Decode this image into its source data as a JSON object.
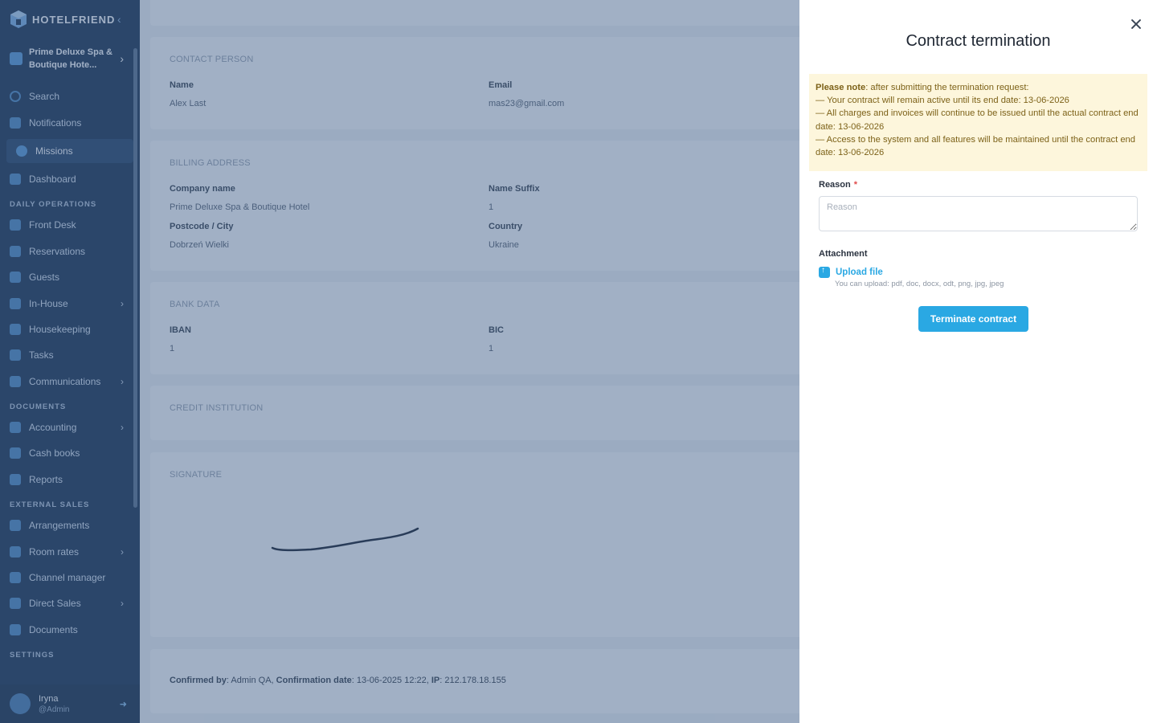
{
  "sidebar": {
    "brand": "HOTELFRIEND",
    "hotel_name": "Prime Deluxe Spa & Boutique Hote...",
    "search": "Search",
    "notifications": "Notifications",
    "missions": "Missions",
    "dashboard": "Dashboard",
    "sections": {
      "daily": "DAILY OPERATIONS",
      "documents": "DOCUMENTS",
      "external": "EXTERNAL SALES",
      "settings": "SETTINGS"
    },
    "daily_items": [
      "Front Desk",
      "Reservations",
      "Guests",
      "In-House",
      "Housekeeping",
      "Tasks",
      "Communications"
    ],
    "document_items": [
      "Accounting",
      "Cash books",
      "Reports"
    ],
    "external_items": [
      "Arrangements",
      "Room rates",
      "Channel manager",
      "Direct Sales",
      "Documents"
    ],
    "user": {
      "name": "Iryna",
      "role": "@Admin"
    }
  },
  "main": {
    "contact": {
      "title": "CONTACT PERSON",
      "name_label": "Name",
      "name_value": "Alex Last",
      "email_label": "Email",
      "email_value": "mas23@gmail.com"
    },
    "billing": {
      "title": "BILLING ADDRESS",
      "company_label": "Company name",
      "company_value": "Prime Deluxe Spa & Boutique Hotel",
      "suffix_label": "Name Suffix",
      "suffix_value": "1",
      "postcode_label": "Postcode / City",
      "postcode_value": "Dobrzeń Wielki",
      "country_label": "Country",
      "country_value": "Ukraine"
    },
    "bank": {
      "title": "BANK DATA",
      "iban_label": "IBAN",
      "iban_value": "1",
      "bic_label": "BIC",
      "bic_value": "1"
    },
    "credit": {
      "title": "CREDIT INSTITUTION"
    },
    "signature": {
      "title": "SIGNATURE"
    },
    "confirm": {
      "by_label": "Confirmed by",
      "by_value": ": Admin QA, ",
      "date_label": "Confirmation date",
      "date_value": ": 13-06-2025 12:22, ",
      "ip_label": "IP",
      "ip_value": ": 212.178.18.155"
    }
  },
  "drawer": {
    "title": "Contract termination",
    "note_bold": "Please note",
    "note_intro": ": after submitting the termination request:",
    "note_lines": [
      "— Your contract will remain active until its end date: 13-06-2026",
      "— All charges and invoices will continue to be issued until the actual contract end date: 13-06-2026",
      "— Access to the system and all features will be maintained until the contract end date: 13-06-2026"
    ],
    "reason_label": "Reason",
    "reason_required": "*",
    "reason_placeholder": "Reason",
    "attachment_label": "Attachment",
    "upload_label": "Upload file",
    "upload_hint": "You can upload: pdf, doc, docx, odt, png, jpg, jpeg",
    "submit_label": "Terminate contract"
  },
  "colors": {
    "accent": "#2aa8e3",
    "sidebar": "#1e3552",
    "note_bg": "#fdf6dc",
    "required": "#e04b4b"
  }
}
